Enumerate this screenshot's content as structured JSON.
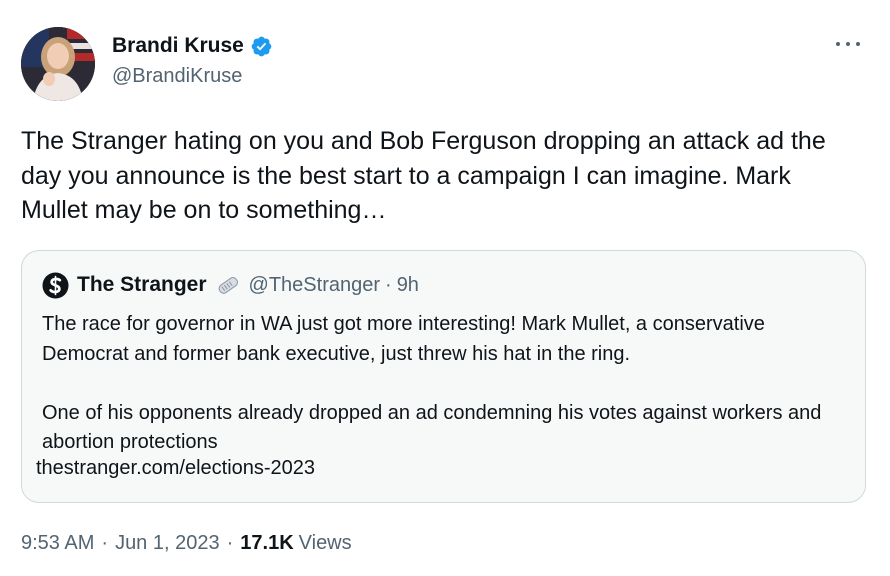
{
  "author": {
    "display_name": "Brandi Kruse",
    "handle": "@BrandiKruse",
    "verified_icon": "verified-badge-icon",
    "avatar": "profile-photo"
  },
  "tweet": {
    "text": "The Stranger hating on you and Bob Ferguson dropping an attack ad the day you announce is the best start to a campaign I can imagine. Mark Mullet may be on to something…"
  },
  "quote": {
    "display_name": "The Stranger",
    "handle": "@TheStranger",
    "separator": "·",
    "time": "9h",
    "logo_icon": "stranger-logo-icon",
    "badge_icon": "newspaper-icon",
    "paragraph1": "The race for governor in WA just got more interesting! Mark Mullet, a conservative Democrat and former bank executive, just threw his hat in the ring.",
    "paragraph2": "One of his opponents already dropped an ad condemning his votes against workers and abortion protections",
    "link": "thestranger.com/elections-2023"
  },
  "meta": {
    "time": "9:53 AM",
    "separator1": "·",
    "date": "Jun 1, 2023",
    "separator2": "·",
    "views_count": "17.1K",
    "views_label": "Views"
  },
  "colors": {
    "text": "#0f1419",
    "secondary": "#536471",
    "verified": "#1d9bf0",
    "border": "#cfd9de",
    "quote_bg": "#f7f9f9"
  }
}
